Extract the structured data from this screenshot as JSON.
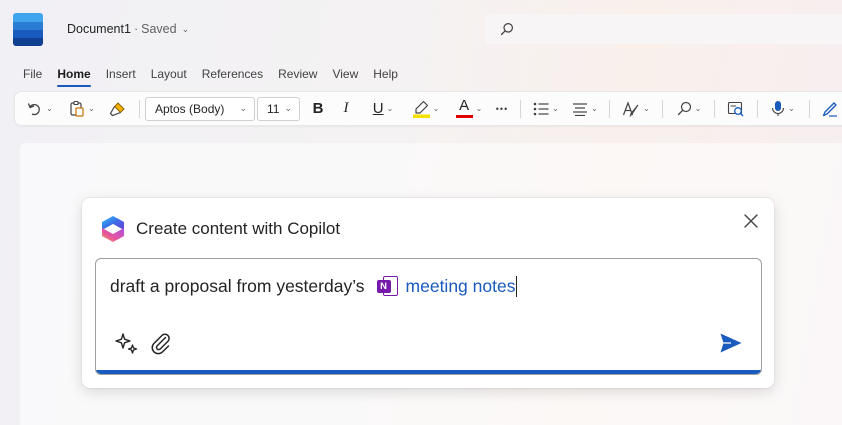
{
  "window": {
    "doc_name": "Document1",
    "separator": "·",
    "save_status": "Saved",
    "search_icon": "search-icon",
    "brand_color": "#185abd"
  },
  "menu": {
    "items": [
      {
        "label": "File"
      },
      {
        "label": "Home",
        "active": true
      },
      {
        "label": "Insert"
      },
      {
        "label": "Layout"
      },
      {
        "label": "References"
      },
      {
        "label": "Review"
      },
      {
        "label": "View"
      },
      {
        "label": "Help"
      }
    ]
  },
  "ribbon": {
    "font_name": "Aptos (Body)",
    "font_size": "11",
    "bold": "B",
    "italic": "I",
    "underline": "U",
    "font_color_letter": "A",
    "more": "•••",
    "highlight_color": "#f5e100",
    "font_color": "#e00000",
    "icons": [
      "undo-icon",
      "paste-icon",
      "format-painter-icon",
      "bullets-icon",
      "align-icon",
      "styles-icon",
      "find-icon",
      "editor-icon",
      "dictate-icon",
      "designer-icon"
    ]
  },
  "copilot": {
    "title": "Create content with Copilot",
    "prompt_text": "draft a proposal from yesterday’s",
    "reference_app_letter": "N",
    "reference_label": "meeting notes",
    "reference_color": "#185abd",
    "onenote_color": "#7719aa",
    "send_color": "#185abd"
  }
}
